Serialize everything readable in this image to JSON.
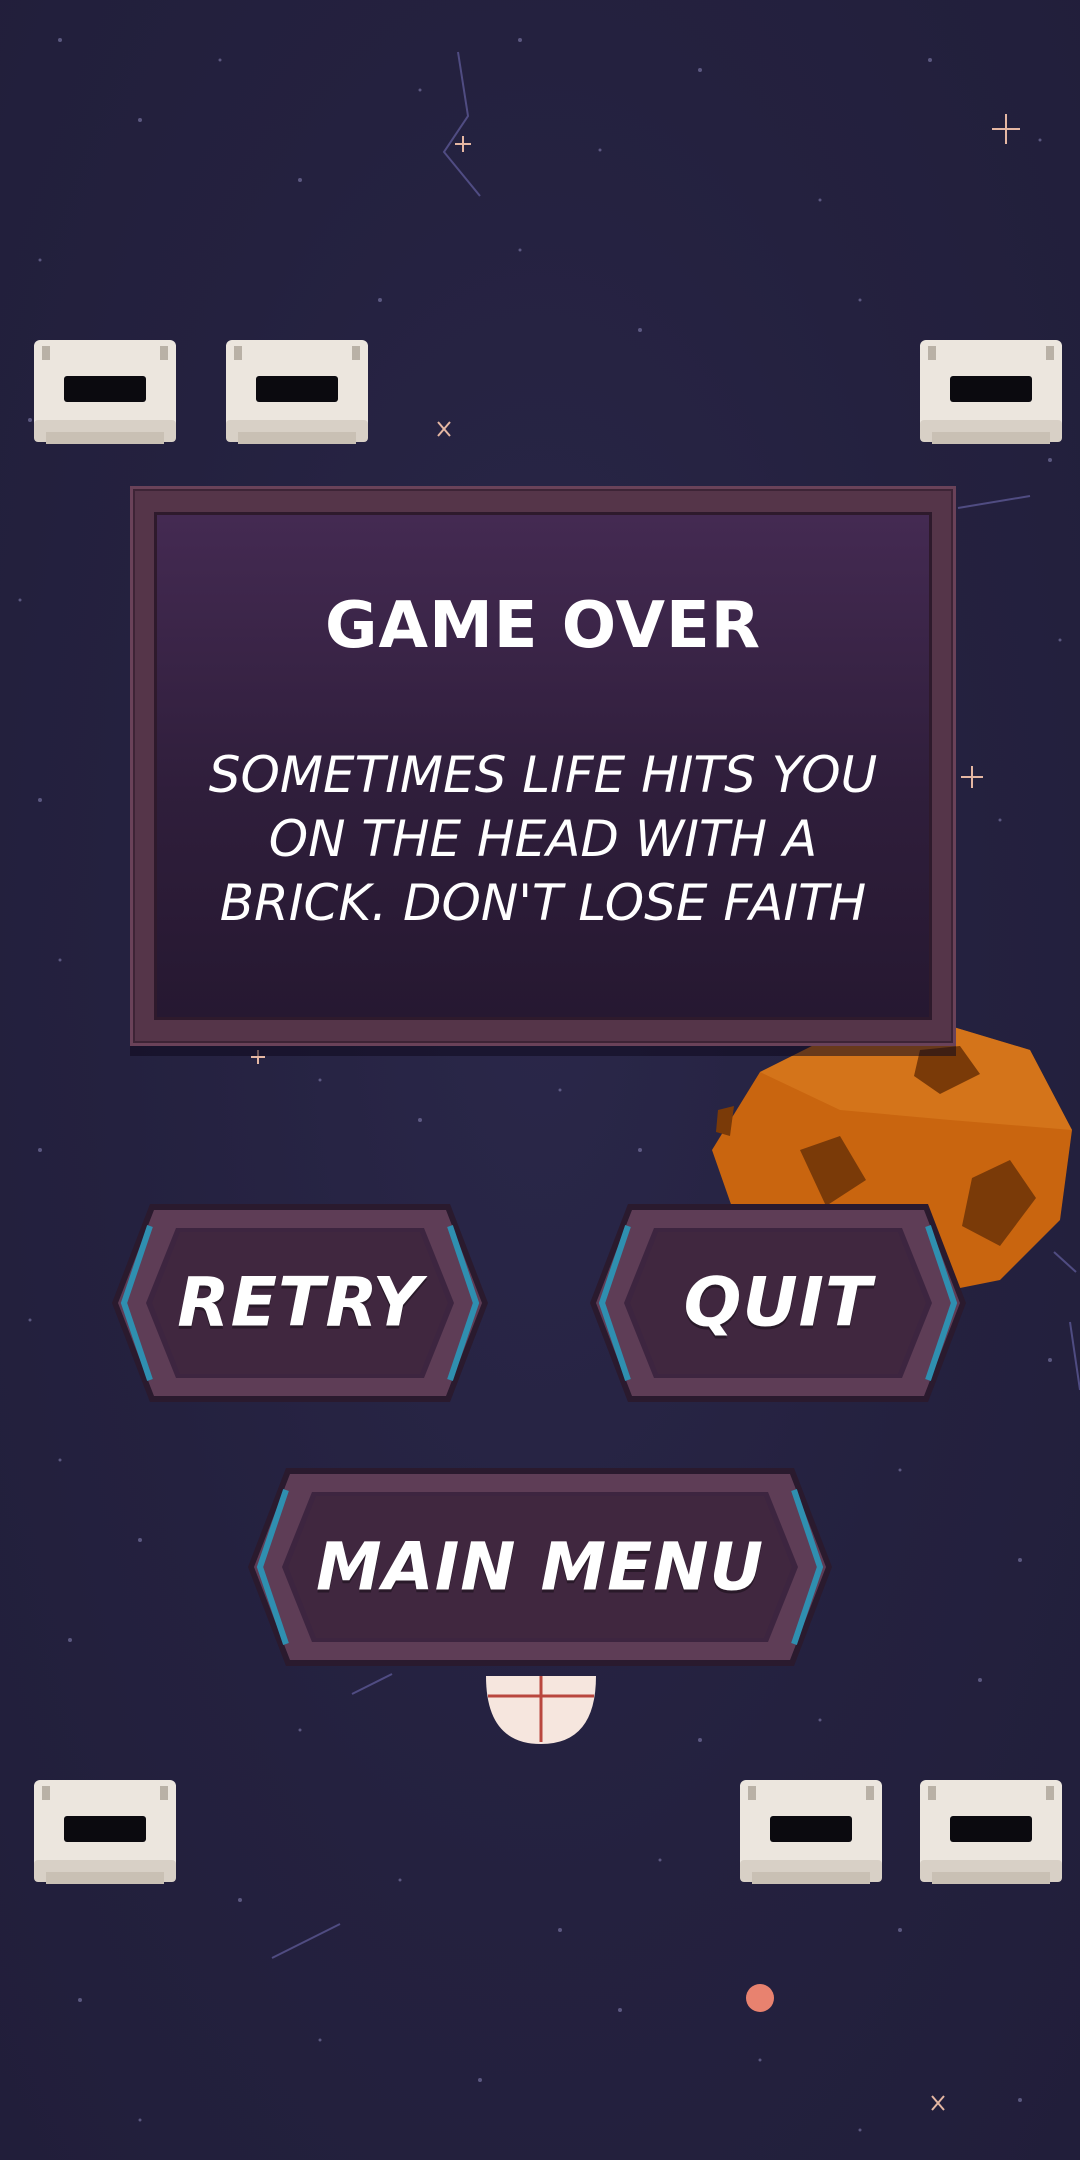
{
  "panel": {
    "title": "GAME OVER",
    "message_lines": [
      "SOMETIMES LIFE HITS YOU",
      "ON THE HEAD WITH A",
      "BRICK. DON'T LOSE FAITH"
    ]
  },
  "buttons": {
    "retry": "RETRY",
    "quit": "QUIT",
    "main_menu": "MAIN MENU"
  },
  "colors": {
    "background": "#24213f",
    "panel_frame": "#553549",
    "panel_fill": "#3a2446",
    "button_fill": "#40273f",
    "button_accent": "#2f8fb0",
    "asteroid": "#c9650f",
    "brick": "#ece6de",
    "ball": "#e8826f"
  },
  "icons": [
    "brick-icon",
    "asteroid-icon",
    "paddle-icon",
    "ball-icon",
    "star-icon"
  ]
}
